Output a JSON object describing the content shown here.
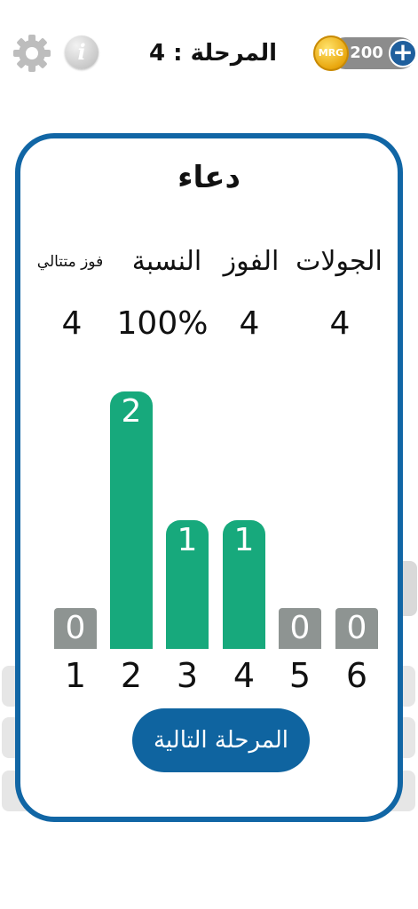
{
  "header": {
    "level_label": "المرحلة : 4",
    "coins": "200",
    "coin_badge": "MRG",
    "info_glyph": "i",
    "plus_glyph": "+"
  },
  "stats": {
    "word": "دعاء",
    "labels": {
      "rounds": "الجولات",
      "wins": "الفوز",
      "ratio": "النسبة",
      "streak": "فوز متتالي"
    },
    "values": {
      "rounds": "4",
      "wins": "4",
      "ratio": "100%",
      "streak": "4"
    }
  },
  "chart_data": {
    "type": "bar",
    "categories": [
      "1",
      "2",
      "3",
      "4",
      "5",
      "6"
    ],
    "values": [
      0,
      2,
      1,
      1,
      0,
      0
    ],
    "ylim": [
      0,
      2
    ],
    "grid": false,
    "colors": {
      "nonzero": "#17a97c",
      "zero": "#8e9492"
    }
  },
  "next_button": {
    "label": "المرحلة التالية"
  },
  "colors": {
    "modal_border": "#1166a5",
    "button": "#0f64a0",
    "coin_pill": "#8c8c8c",
    "plus": "#1f5f9d"
  }
}
